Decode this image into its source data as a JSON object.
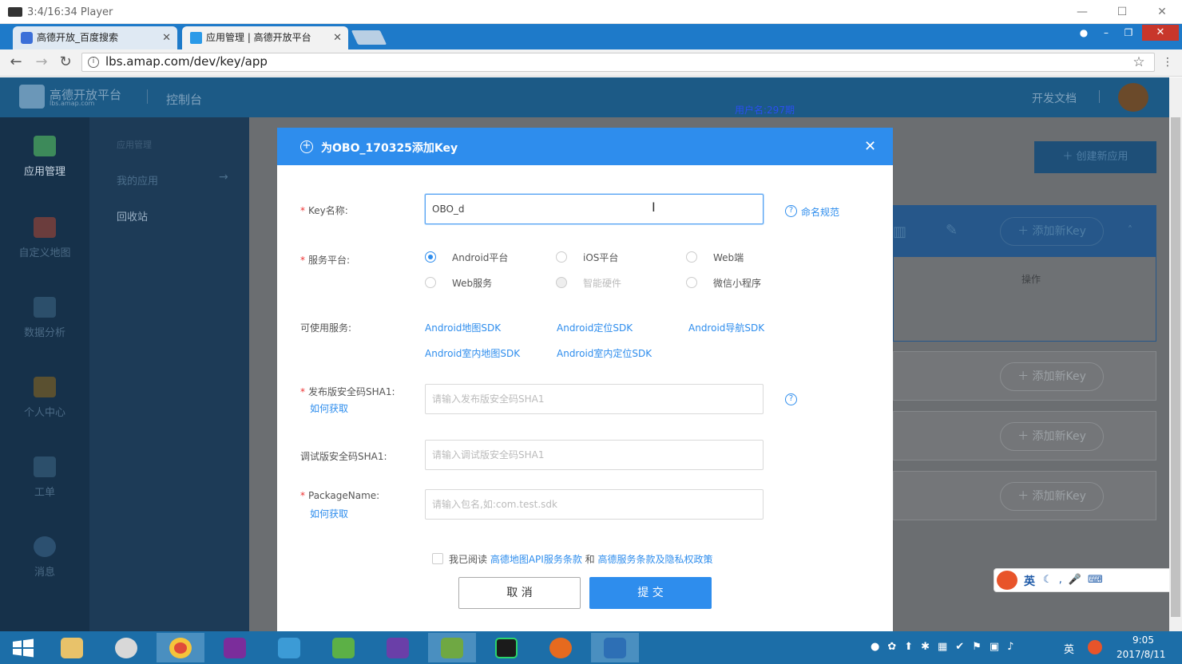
{
  "player": {
    "title": "3:4/16:34 Player",
    "minimize": "—",
    "maximize": "☐",
    "close": "✕"
  },
  "browser": {
    "tabs": [
      {
        "label": "高德开放_百度搜索",
        "close": "✕"
      },
      {
        "label": "应用管理 | 高德开放平台",
        "close": "✕"
      }
    ],
    "url": "lbs.amap.com/dev/key/app"
  },
  "header": {
    "logo_text": "高德开放平台",
    "logo_sub": "lbs.amap.com",
    "console": "控制台",
    "docs": "开发文档",
    "username": "用户名:297期"
  },
  "sidebar": {
    "items": [
      {
        "label": "应用管理",
        "active": true
      },
      {
        "label": "自定义地图"
      },
      {
        "label": "数据分析"
      },
      {
        "label": "个人中心"
      },
      {
        "label": "工单"
      },
      {
        "label": "消息"
      }
    ]
  },
  "subnav": {
    "heading": "应用管理",
    "items": [
      "我的应用",
      "回收站"
    ]
  },
  "content": {
    "create_app": "＋ 创建新应用",
    "add_key": "＋ 添加新Key",
    "ops": "操作"
  },
  "modal": {
    "title": "为OBO_170325添加Key",
    "key_name_label": "Key名称:",
    "key_name_value": "OBO_d",
    "naming_rule": "命名规范",
    "platform_label": "服务平台:",
    "platforms": [
      {
        "label": "Android平台",
        "selected": true
      },
      {
        "label": "iOS平台"
      },
      {
        "label": "Web端"
      },
      {
        "label": "Web服务"
      },
      {
        "label": "智能硬件",
        "disabled": true
      },
      {
        "label": "微信小程序"
      }
    ],
    "services_label": "可使用服务:",
    "services": [
      "Android地图SDK",
      "Android定位SDK",
      "Android导航SDK",
      "Android室内地图SDK",
      "Android室内定位SDK"
    ],
    "release_sha1_label": "发布版安全码SHA1:",
    "how_to_get": "如何获取",
    "release_sha1_placeholder": "请输入发布版安全码SHA1",
    "debug_sha1_label": "调试版安全码SHA1:",
    "debug_sha1_placeholder": "请输入调试版安全码SHA1",
    "package_label": "PackageName:",
    "package_placeholder": "请输入包名,如:com.test.sdk",
    "agree_prefix": "我已阅读",
    "agree_link1": "高德地图API服务条款",
    "agree_and": "和",
    "agree_link2": "高德服务条款及隐私权政策",
    "cancel": "取 消",
    "submit": "提 交"
  },
  "ime": {
    "lang": "英"
  },
  "taskbar": {
    "time": "9:05",
    "date": "2017/8/11",
    "lang": "英"
  },
  "colors": {
    "primary": "#2e8ded",
    "header": "#1c5a86",
    "sidebar": "#16314a",
    "taskbar": "#1c6ea8"
  }
}
